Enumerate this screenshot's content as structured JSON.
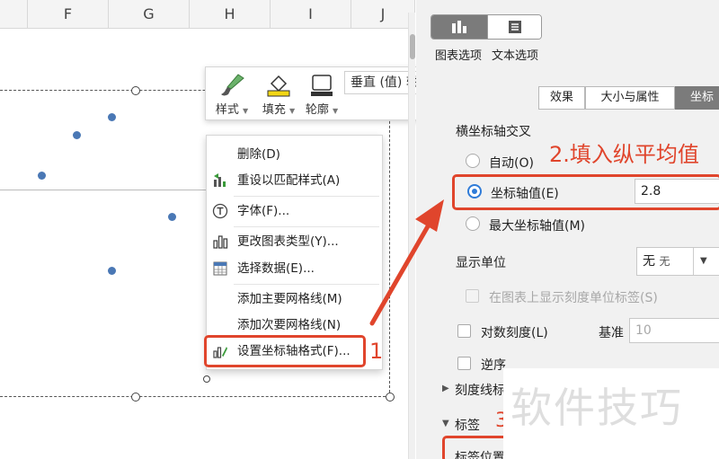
{
  "sheet": {
    "columns": [
      "F",
      "G",
      "H",
      "I",
      "J"
    ]
  },
  "mini_toolbar": {
    "style_label": "样式",
    "fill_label": "填充",
    "outline_label": "轮廓",
    "element_select": "垂直 (值) 轴"
  },
  "context_menu": {
    "items": [
      {
        "label": "删除(D)",
        "icon": "none"
      },
      {
        "label": "重设以匹配样式(A)",
        "icon": "reset-style-icon"
      },
      {
        "label": "字体(F)...",
        "icon": "font-icon"
      },
      {
        "label": "更改图表类型(Y)...",
        "icon": "chart-type-icon"
      },
      {
        "label": "选择数据(E)...",
        "icon": "select-data-icon"
      },
      {
        "label": "添加主要网格线(M)",
        "icon": "none"
      },
      {
        "label": "添加次要网格线(N)",
        "icon": "none"
      },
      {
        "label": "设置坐标轴格式(F)...",
        "icon": "axis-format-icon"
      }
    ]
  },
  "annotations": {
    "step1": "1",
    "step2": "2.填入纵平均值",
    "step3": "3"
  },
  "panel": {
    "chart_options_label": "图表选项",
    "text_options_label": "文本选项",
    "tabs": [
      "效果",
      "大小与属性",
      "坐标"
    ],
    "section_cross": "横坐标轴交叉",
    "radio_auto": "自动(O)",
    "radio_value": "坐标轴值(E)",
    "cross_value": "2.8",
    "radio_max": "最大坐标轴值(M)",
    "display_unit_label": "显示单位",
    "display_unit_value": "无",
    "display_unit_hint": "无",
    "show_unit_label": "在图表上显示刻度单位标签(S)",
    "log_scale_label": "对数刻度(L)",
    "base_label": "基准",
    "base_value": "10",
    "reverse_label": "逆序",
    "tick_section": "刻度线标",
    "label_section": "标签",
    "label_position": "标签位置"
  },
  "watermark": "软件技巧",
  "colors": {
    "accent_red": "#e0452c",
    "point_blue": "#4a78b5",
    "radio_blue": "#2f7bd8"
  }
}
